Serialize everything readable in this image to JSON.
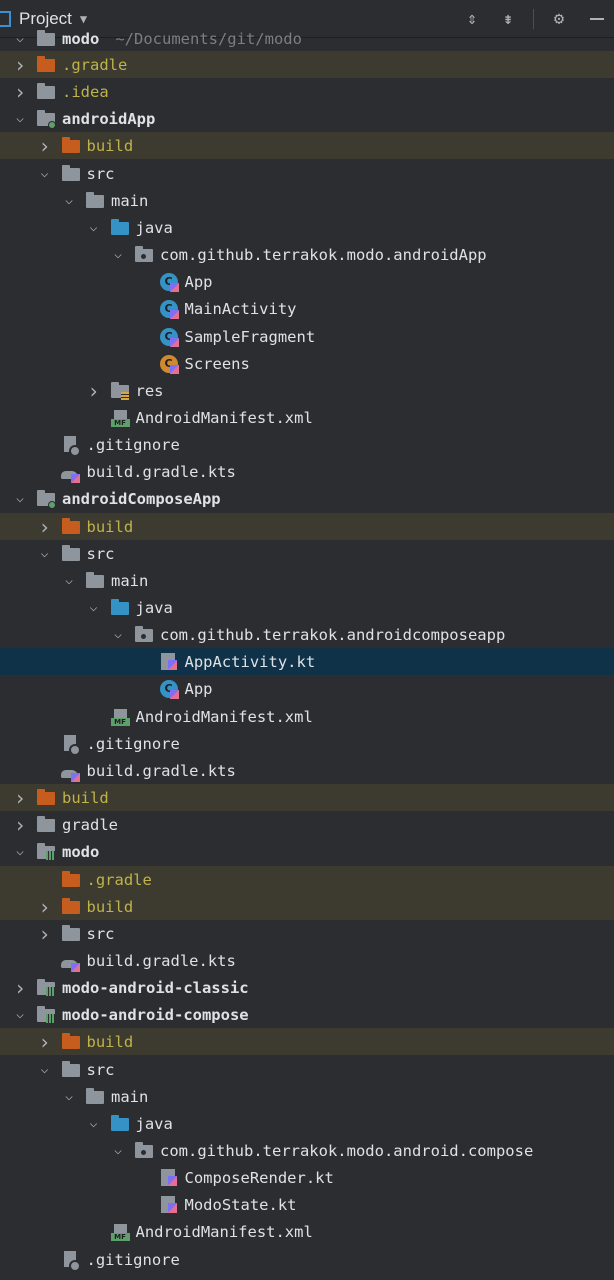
{
  "toolbar": {
    "title": "Project",
    "icons": [
      "expand-all-icon",
      "collapse-all-icon",
      "gear-icon",
      "minimize-icon"
    ]
  },
  "tree": [
    {
      "name": "modo",
      "path": "~/Documents/git/modo",
      "depth": 0,
      "arrow": "down",
      "icon": "folder-gray",
      "bold": true,
      "cut": true
    },
    {
      "name": ".gradle",
      "depth": 0,
      "arrow": "right",
      "icon": "folder-orange",
      "excluded": true
    },
    {
      "name": ".idea",
      "depth": 0,
      "arrow": "right",
      "icon": "folder-gray",
      "excluded": false,
      "dim": true
    },
    {
      "name": "androidApp",
      "depth": 0,
      "arrow": "down",
      "icon": "module",
      "bold": true
    },
    {
      "name": "build",
      "depth": 1,
      "arrow": "right",
      "icon": "folder-orange",
      "excluded": true
    },
    {
      "name": "src",
      "depth": 1,
      "arrow": "down",
      "icon": "folder-gray"
    },
    {
      "name": "main",
      "depth": 2,
      "arrow": "down",
      "icon": "folder-gray"
    },
    {
      "name": "java",
      "depth": 3,
      "arrow": "down",
      "icon": "folder-blue"
    },
    {
      "name": "com.github.terrakok.modo.androidApp",
      "depth": 4,
      "arrow": "down",
      "icon": "package"
    },
    {
      "name": "App",
      "depth": 5,
      "arrow": "none",
      "icon": "kotlin-class"
    },
    {
      "name": "MainActivity",
      "depth": 5,
      "arrow": "none",
      "icon": "kotlin-class"
    },
    {
      "name": "SampleFragment",
      "depth": 5,
      "arrow": "none",
      "icon": "kotlin-class"
    },
    {
      "name": "Screens",
      "depth": 5,
      "arrow": "none",
      "icon": "kotlin-object"
    },
    {
      "name": "res",
      "depth": 3,
      "arrow": "right",
      "icon": "res-folder"
    },
    {
      "name": "AndroidManifest.xml",
      "depth": 3,
      "arrow": "none",
      "icon": "manifest"
    },
    {
      "name": ".gitignore",
      "depth": 1,
      "arrow": "none",
      "icon": "gitignore"
    },
    {
      "name": "build.gradle.kts",
      "depth": 1,
      "arrow": "none",
      "icon": "gradle-kts"
    },
    {
      "name": "androidComposeApp",
      "depth": 0,
      "arrow": "down",
      "icon": "module",
      "bold": true
    },
    {
      "name": "build",
      "depth": 1,
      "arrow": "right",
      "icon": "folder-orange",
      "excluded": true
    },
    {
      "name": "src",
      "depth": 1,
      "arrow": "down",
      "icon": "folder-gray"
    },
    {
      "name": "main",
      "depth": 2,
      "arrow": "down",
      "icon": "folder-gray"
    },
    {
      "name": "java",
      "depth": 3,
      "arrow": "down",
      "icon": "folder-blue"
    },
    {
      "name": "com.github.terrakok.androidcomposeapp",
      "depth": 4,
      "arrow": "down",
      "icon": "package"
    },
    {
      "name": "AppActivity.kt",
      "depth": 5,
      "arrow": "none",
      "icon": "kotlin-file",
      "selected": true
    },
    {
      "name": "App",
      "depth": 5,
      "arrow": "none",
      "icon": "kotlin-class"
    },
    {
      "name": "AndroidManifest.xml",
      "depth": 3,
      "arrow": "none",
      "icon": "manifest"
    },
    {
      "name": ".gitignore",
      "depth": 1,
      "arrow": "none",
      "icon": "gitignore"
    },
    {
      "name": "build.gradle.kts",
      "depth": 1,
      "arrow": "none",
      "icon": "gradle-kts"
    },
    {
      "name": "build",
      "depth": 0,
      "arrow": "right",
      "icon": "folder-orange",
      "excluded": true
    },
    {
      "name": "gradle",
      "depth": 0,
      "arrow": "right",
      "icon": "folder-gray"
    },
    {
      "name": "modo",
      "depth": 0,
      "arrow": "down",
      "icon": "module-bars",
      "bold": true
    },
    {
      "name": ".gradle",
      "depth": 1,
      "arrow": "none",
      "icon": "folder-orange",
      "excluded": true
    },
    {
      "name": "build",
      "depth": 1,
      "arrow": "right",
      "icon": "folder-orange",
      "excluded": true
    },
    {
      "name": "src",
      "depth": 1,
      "arrow": "right",
      "icon": "folder-gray"
    },
    {
      "name": "build.gradle.kts",
      "depth": 1,
      "arrow": "none",
      "icon": "gradle-kts"
    },
    {
      "name": "modo-android-classic",
      "depth": 0,
      "arrow": "right",
      "icon": "module-bars",
      "bold": true
    },
    {
      "name": "modo-android-compose",
      "depth": 0,
      "arrow": "down",
      "icon": "module-bars",
      "bold": true
    },
    {
      "name": "build",
      "depth": 1,
      "arrow": "right",
      "icon": "folder-orange",
      "excluded": true
    },
    {
      "name": "src",
      "depth": 1,
      "arrow": "down",
      "icon": "folder-gray"
    },
    {
      "name": "main",
      "depth": 2,
      "arrow": "down",
      "icon": "folder-gray"
    },
    {
      "name": "java",
      "depth": 3,
      "arrow": "down",
      "icon": "folder-blue"
    },
    {
      "name": "com.github.terrakok.modo.android.compose",
      "depth": 4,
      "arrow": "down",
      "icon": "package"
    },
    {
      "name": "ComposeRender.kt",
      "depth": 5,
      "arrow": "none",
      "icon": "kotlin-file"
    },
    {
      "name": "ModoState.kt",
      "depth": 5,
      "arrow": "none",
      "icon": "kotlin-file"
    },
    {
      "name": "AndroidManifest.xml",
      "depth": 3,
      "arrow": "none",
      "icon": "manifest"
    },
    {
      "name": ".gitignore",
      "depth": 1,
      "arrow": "none",
      "icon": "gitignore"
    }
  ],
  "colors": {
    "background": "#2b2d30",
    "excluded_row": "#3d3b2f",
    "selected_row": "#0f3249",
    "excluded_text": "#bfb34a"
  }
}
